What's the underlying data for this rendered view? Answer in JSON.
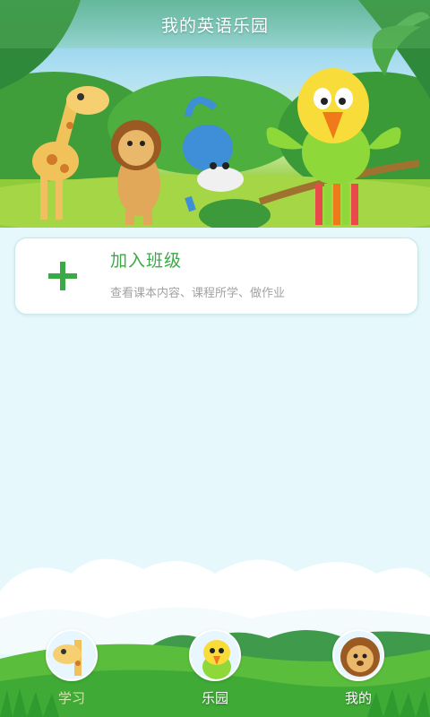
{
  "header": {
    "title": "我的英语乐园"
  },
  "join_card": {
    "title": "加入班级",
    "subtitle": "查看课本内容、课程所学、做作业",
    "icon": "plus-icon",
    "accent_color": "#3aaa46"
  },
  "tabs": [
    {
      "label": "学习",
      "icon": "giraffe-avatar-icon",
      "active": true
    },
    {
      "label": "乐园",
      "icon": "parrot-avatar-icon",
      "active": false
    },
    {
      "label": "我的",
      "icon": "lion-avatar-icon",
      "active": false
    }
  ],
  "colors": {
    "background": "#e6f8fb",
    "accent": "#3aaa46",
    "subtext": "#a2a2a2"
  }
}
